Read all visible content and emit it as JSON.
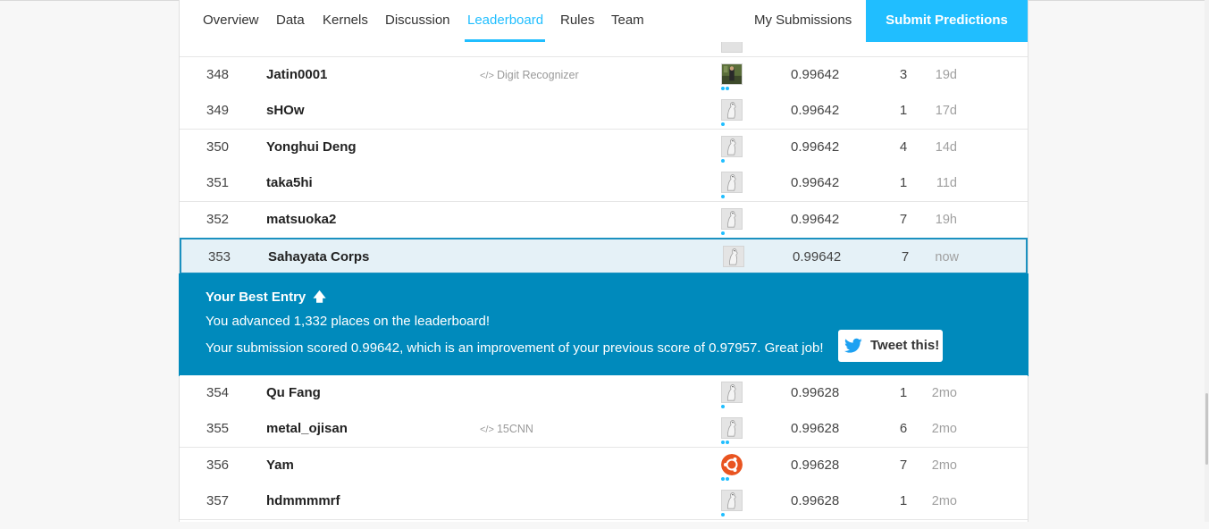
{
  "nav": {
    "tabs": [
      {
        "label": "Overview"
      },
      {
        "label": "Data"
      },
      {
        "label": "Kernels"
      },
      {
        "label": "Discussion"
      },
      {
        "label": "Leaderboard",
        "active": true
      },
      {
        "label": "Rules"
      },
      {
        "label": "Team"
      }
    ],
    "my_submissions": "My Submissions",
    "submit": "Submit Predictions"
  },
  "rows_above": [
    {
      "rank": "348",
      "name": "Jatin0001",
      "kernel": "Digit Recognizer",
      "avatar": "photo",
      "dots": 2,
      "score": "0.99642",
      "entries": "3",
      "last": "19d"
    },
    {
      "rank": "349",
      "name": "sHOw",
      "kernel": "",
      "avatar": "default",
      "dots": 1,
      "score": "0.99642",
      "entries": "1",
      "last": "17d"
    },
    {
      "rank": "350",
      "name": "Yonghui Deng",
      "kernel": "",
      "avatar": "default",
      "dots": 1,
      "score": "0.99642",
      "entries": "4",
      "last": "14d"
    },
    {
      "rank": "351",
      "name": "taka5hi",
      "kernel": "",
      "avatar": "default",
      "dots": 1,
      "score": "0.99642",
      "entries": "1",
      "last": "11d"
    },
    {
      "rank": "352",
      "name": "matsuoka2",
      "kernel": "",
      "avatar": "default",
      "dots": 1,
      "score": "0.99642",
      "entries": "7",
      "last": "19h"
    }
  ],
  "my_row": {
    "rank": "353",
    "name": "Sahayata Corps",
    "kernel": "",
    "avatar": "default",
    "dots": 0,
    "score": "0.99642",
    "entries": "7",
    "last": "now"
  },
  "best_entry": {
    "title": "Your Best Entry",
    "arrow": "🡅",
    "line1": "You advanced 1,332 places on the leaderboard!",
    "line2": "Your submission scored 0.99642, which is an improvement of your previous score of 0.97957. Great job!",
    "tweet": "Tweet this!"
  },
  "rows_below": [
    {
      "rank": "354",
      "name": "Qu Fang",
      "kernel": "",
      "avatar": "default",
      "dots": 1,
      "score": "0.99628",
      "entries": "1",
      "last": "2mo"
    },
    {
      "rank": "355",
      "name": "metal_ojisan",
      "kernel": "15CNN",
      "avatar": "default",
      "dots": 2,
      "score": "0.99628",
      "entries": "6",
      "last": "2mo"
    },
    {
      "rank": "356",
      "name": "Yam",
      "kernel": "",
      "avatar": "ubuntu",
      "dots": 2,
      "score": "0.99628",
      "entries": "7",
      "last": "2mo"
    },
    {
      "rank": "357",
      "name": "hdmmmmrf",
      "kernel": "",
      "avatar": "default",
      "dots": 1,
      "score": "0.99628",
      "entries": "1",
      "last": "2mo"
    }
  ],
  "colors": {
    "accent": "#20beff",
    "banner": "#008abc",
    "highlight_border": "#1b91c0"
  },
  "icons": {
    "kernel": "code-icon",
    "tweet": "twitter-icon"
  }
}
